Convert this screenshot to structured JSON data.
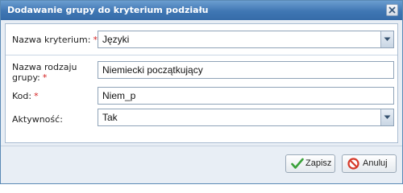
{
  "dialog": {
    "title": "Dodawanie grupy do kryterium podziału"
  },
  "form": {
    "criterion_label": "Nazwa kryterium:",
    "criterion_value": "Języki",
    "group_name_label_line1": "Nazwa rodzaju",
    "group_name_label_line2": "grupy:",
    "group_name_value": "Niemiecki początkujący",
    "code_label": "Kod:",
    "code_value": "Niem_p",
    "active_label": "Aktywność:",
    "active_value": "Tak",
    "required_marker": "*"
  },
  "buttons": {
    "save_label": "Zapisz",
    "cancel_label": "Anuluj"
  },
  "icons": {
    "close": "close-icon",
    "dropdown": "chevron-down-icon",
    "save": "checkmark-icon",
    "cancel": "no-entry-icon"
  },
  "colors": {
    "titlebar": "#3f76b3",
    "required": "#d42020",
    "save_icon": "#3aa13a",
    "cancel_icon": "#d63a2a"
  }
}
